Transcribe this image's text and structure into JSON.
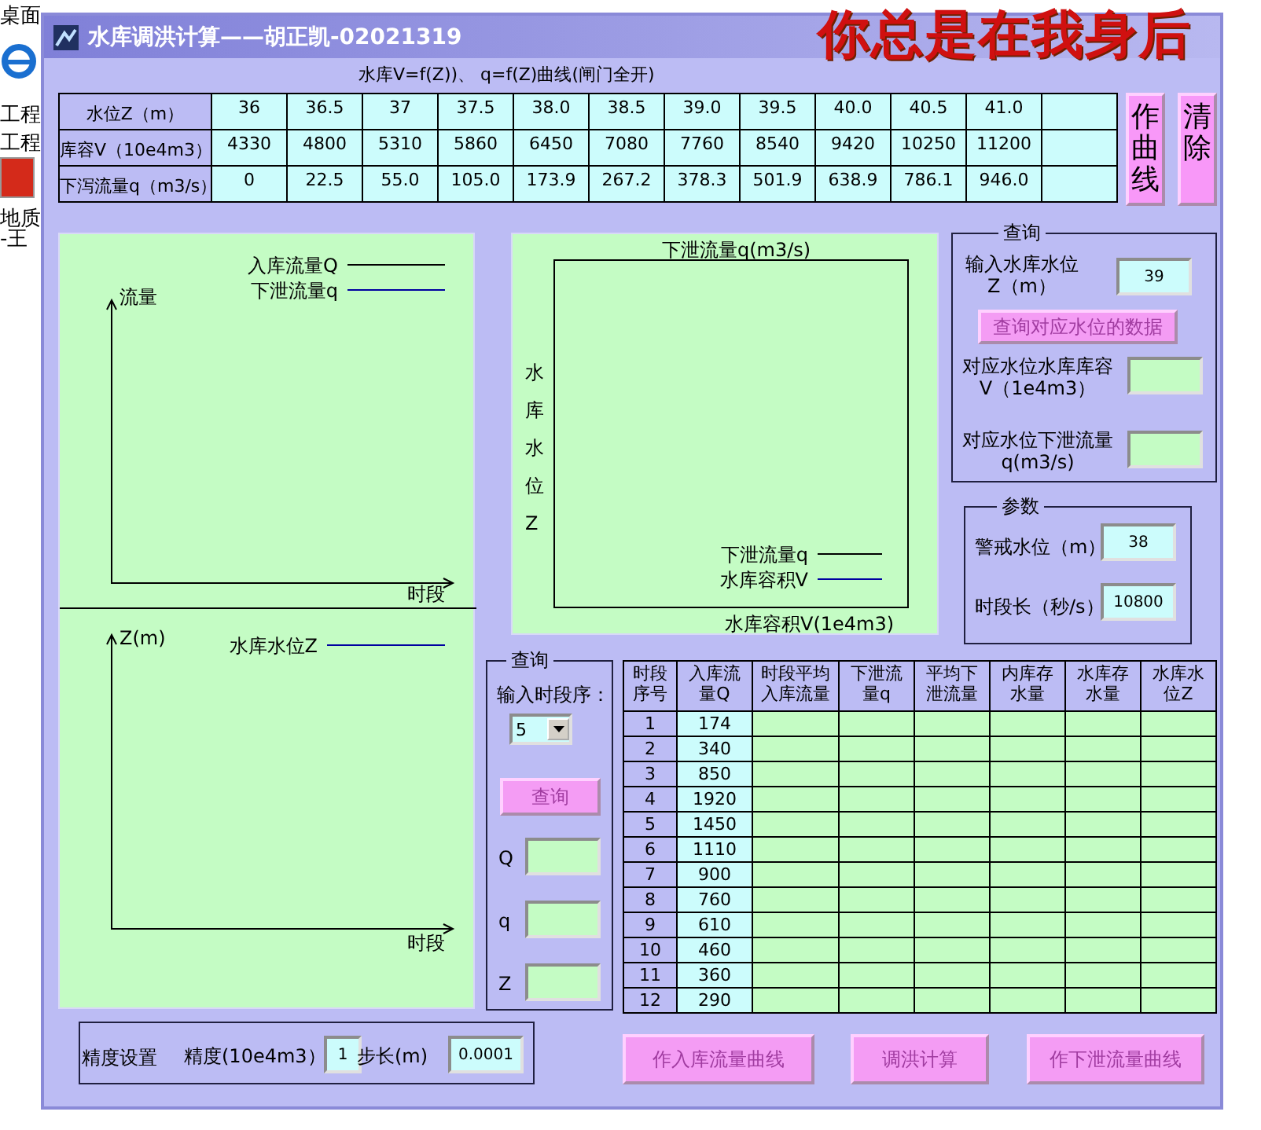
{
  "desktop": {
    "labels": [
      {
        "text": "桌面"
      },
      {
        "text": "工程"
      },
      {
        "text": "工程"
      },
      {
        "text": "地质"
      },
      {
        "text": "-王"
      }
    ]
  },
  "window": {
    "title": "水库调洪计算——胡正凯-02021319",
    "overlay_caption": "你总是在我身后"
  },
  "curve_table": {
    "caption": "水库V=f(Z))、 q=f(Z)曲线(闸门全开)",
    "rows": [
      {
        "header": "水位Z（m）",
        "values": [
          "36",
          "36.5",
          "37",
          "37.5",
          "38.0",
          "38.5",
          "39.0",
          "39.5",
          "40.0",
          "40.5",
          "41.0"
        ]
      },
      {
        "header": "库容V（10e4m3）",
        "values": [
          "4330",
          "4800",
          "5310",
          "5860",
          "6450",
          "7080",
          "7760",
          "8540",
          "9420",
          "10250",
          "11200"
        ]
      },
      {
        "header": "下泻流量q（m3/s）",
        "values": [
          "0",
          "22.5",
          "55.0",
          "105.0",
          "173.9",
          "267.2",
          "378.3",
          "501.9",
          "638.9",
          "786.1",
          "946.0"
        ]
      }
    ]
  },
  "side_buttons": [
    {
      "label": "作曲线"
    },
    {
      "label": "清除"
    }
  ],
  "flow_chart": {
    "y_label": "流量",
    "x_label": "时段",
    "legend": [
      {
        "label": "入库流量Q",
        "color": "#000000"
      },
      {
        "label": "下泄流量q",
        "color": "#0000a0"
      }
    ]
  },
  "level_chart": {
    "y_label": "Z(m)",
    "x_label": "时段",
    "legend": [
      {
        "label": "水库水位Z",
        "color": "#0000a0"
      }
    ]
  },
  "curve_chart": {
    "top_label": "下泄流量q(m3/s)",
    "left_label": "水库水位Z",
    "bottom_label": "水库容积V(1e4m3)",
    "legend": [
      {
        "label": "下泄流量q",
        "color": "#000000"
      },
      {
        "label": "水库容积V",
        "color": "#0000a0"
      }
    ]
  },
  "level_query": {
    "title": "查询",
    "input_label": "输入水库水位\nZ（m）",
    "value": "39",
    "button": {
      "label": "查询对应水位的数据",
      "disabled": true
    },
    "outputs": [
      {
        "label": "对应水位水库库容\nV（1e4m3）"
      },
      {
        "label": "对应水位下泄流量\nq(m3/s)"
      }
    ]
  },
  "params": {
    "title": "参数",
    "fields": [
      {
        "label": "警戒水位（m）",
        "value": "38"
      },
      {
        "label": "时段长（秒/s）",
        "value": "10800"
      }
    ]
  },
  "period_query": {
    "title": "查询",
    "input_label": "输入时段序：",
    "selected_value": "5",
    "button": {
      "label": "查询",
      "disabled": true
    },
    "outputs": [
      {
        "label": "Q"
      },
      {
        "label": "q"
      },
      {
        "label": "Z"
      }
    ]
  },
  "routing_table": {
    "columns": [
      "时段序号",
      "入库流量Q",
      "时段平均入库流量",
      "下泄流量q",
      "平均下泄流量",
      "内库存水量",
      "水库存水量",
      "水库水位Z"
    ],
    "rows": [
      {
        "no": "1",
        "inflow": "174"
      },
      {
        "no": "2",
        "inflow": "340"
      },
      {
        "no": "3",
        "inflow": "850"
      },
      {
        "no": "4",
        "inflow": "1920"
      },
      {
        "no": "5",
        "inflow": "1450"
      },
      {
        "no": "6",
        "inflow": "1110"
      },
      {
        "no": "7",
        "inflow": "900"
      },
      {
        "no": "8",
        "inflow": "760"
      },
      {
        "no": "9",
        "inflow": "610"
      },
      {
        "no": "10",
        "inflow": "460"
      },
      {
        "no": "11",
        "inflow": "360"
      },
      {
        "no": "12",
        "inflow": "290"
      }
    ]
  },
  "precision": {
    "title": "精度设置",
    "fields": [
      {
        "label": "精度(10e4m3）",
        "value": "1"
      },
      {
        "label": "步长(m)",
        "value": "0.0001"
      }
    ]
  },
  "action_buttons": [
    {
      "label": "作入库流量曲线",
      "disabled": true
    },
    {
      "label": "调洪计算",
      "disabled": true
    },
    {
      "label": "作下泄流量曲线",
      "disabled": true
    }
  ]
}
